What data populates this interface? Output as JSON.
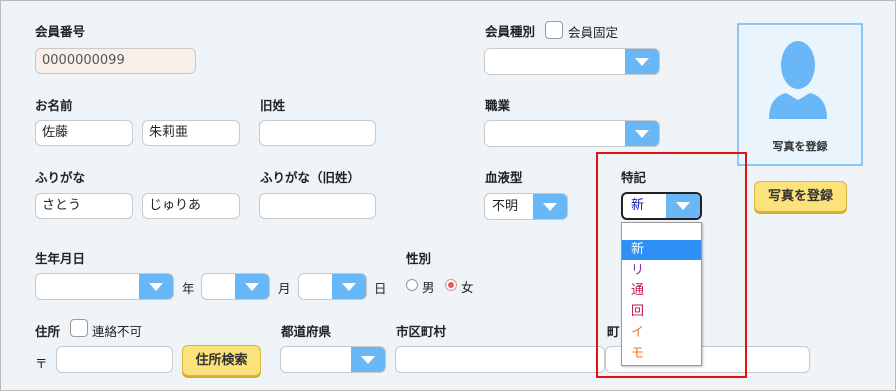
{
  "member_no": {
    "label": "会員番号",
    "value": "0000000099"
  },
  "member_type": {
    "label": "会員種別",
    "fixed_label": "会員固定",
    "value": ""
  },
  "name": {
    "label": "お名前",
    "last": "佐藤",
    "first": "朱莉亜"
  },
  "maiden": {
    "label": "旧姓",
    "value": ""
  },
  "occupation": {
    "label": "職業",
    "value": ""
  },
  "furigana": {
    "label": "ふりがな",
    "last": "さとう",
    "first": "じゅりあ"
  },
  "furigana_maiden": {
    "label": "ふりがな（旧姓）",
    "value": ""
  },
  "blood_type": {
    "label": "血液型",
    "value": "不明"
  },
  "notes": {
    "label": "特記",
    "value": "新",
    "options": [
      {
        "label": "",
        "color": "#222222"
      },
      {
        "label": "新",
        "color": "#ffffff"
      },
      {
        "label": "リ",
        "color": "#7b2fa8"
      },
      {
        "label": "通",
        "color": "#c0174e"
      },
      {
        "label": "回",
        "color": "#c0174e"
      },
      {
        "label": "イ",
        "color": "#e87b2d"
      },
      {
        "label": "モ",
        "color": "#e87b2d"
      }
    ],
    "highlighted_index": 1
  },
  "photo": {
    "caption": "写真を登録",
    "button": "写真を登録"
  },
  "birthdate": {
    "label": "生年月日",
    "year_unit": "年",
    "month_unit": "月",
    "day_unit": "日"
  },
  "gender": {
    "label": "性別",
    "male": "男",
    "female": "女",
    "selected": "女"
  },
  "address": {
    "label": "住所",
    "no_contact_label": "連絡不可",
    "postal_mark": "〒",
    "search_button": "住所検索"
  },
  "prefecture": {
    "label": "都道府県"
  },
  "city": {
    "label": "市区町村"
  },
  "town": {
    "label": "町"
  },
  "colors": {
    "accent": "#6ab7f7",
    "button_yellow": "#fce27a",
    "highlight_border": "#e01212",
    "selection": "#2e8ff5"
  }
}
